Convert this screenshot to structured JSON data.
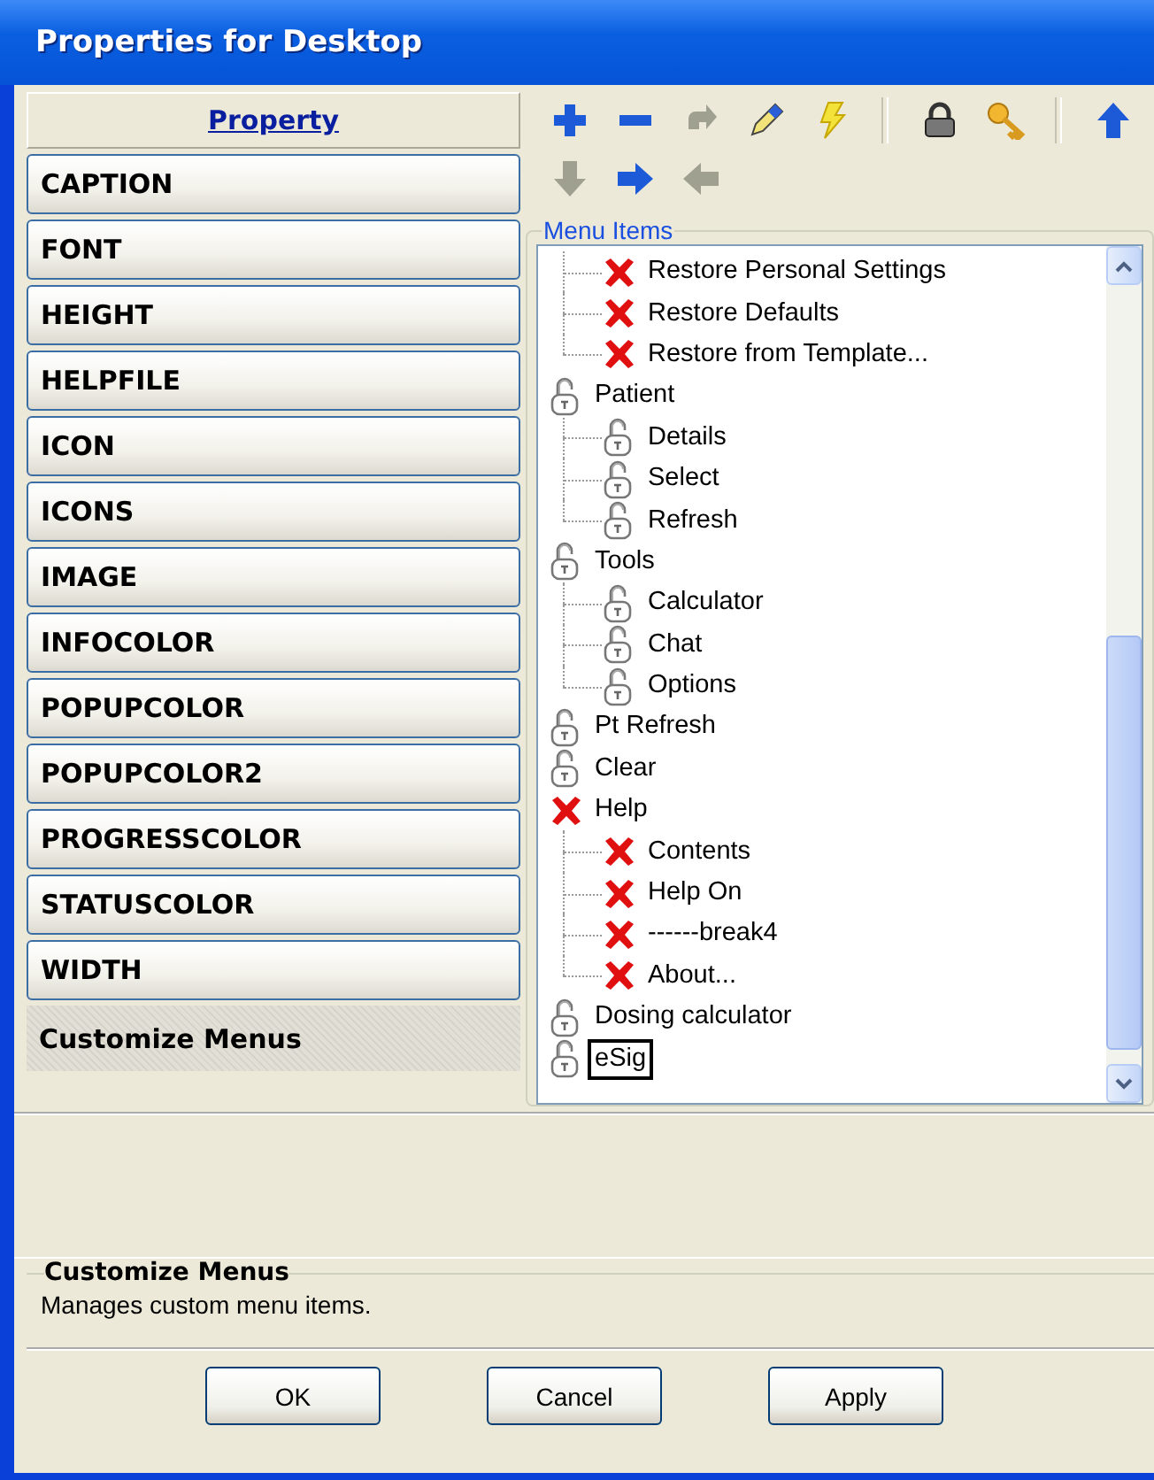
{
  "window": {
    "title": "Properties for Desktop"
  },
  "property_list": {
    "header": "Property",
    "items": [
      {
        "label": "CAPTION",
        "selected": false
      },
      {
        "label": "FONT",
        "selected": false
      },
      {
        "label": "HEIGHT",
        "selected": false
      },
      {
        "label": "HELPFILE",
        "selected": false
      },
      {
        "label": "ICON",
        "selected": false
      },
      {
        "label": "ICONS",
        "selected": false
      },
      {
        "label": "IMAGE",
        "selected": false
      },
      {
        "label": "INFOCOLOR",
        "selected": false
      },
      {
        "label": "POPUPCOLOR",
        "selected": false
      },
      {
        "label": "POPUPCOLOR2",
        "selected": false
      },
      {
        "label": "PROGRESSCOLOR",
        "selected": false
      },
      {
        "label": "STATUSCOLOR",
        "selected": false
      },
      {
        "label": "WIDTH",
        "selected": false
      },
      {
        "label": "Customize Menus",
        "selected": true
      }
    ]
  },
  "toolbar": [
    {
      "kind": "plus",
      "disabled": false
    },
    {
      "kind": "minus",
      "disabled": false
    },
    {
      "kind": "redo",
      "disabled": true
    },
    {
      "kind": "pencil",
      "disabled": false
    },
    {
      "kind": "lightning",
      "disabled": false
    },
    {
      "kind": "separator"
    },
    {
      "kind": "padlock",
      "disabled": false
    },
    {
      "kind": "key",
      "disabled": false
    },
    {
      "kind": "separator"
    },
    {
      "kind": "up",
      "disabled": false
    },
    {
      "kind": "down",
      "disabled": true
    },
    {
      "kind": "right",
      "disabled": false
    },
    {
      "kind": "left",
      "disabled": true
    }
  ],
  "menu_items": {
    "title": "Menu Items",
    "tree": [
      {
        "children": [
          {
            "label": "Restore Personal Settings",
            "kind": "hidden",
            "editing": false
          },
          {
            "label": "Restore Defaults",
            "kind": "hidden",
            "editing": false
          },
          {
            "label": "Restore from Template...",
            "kind": "hidden",
            "editing": false
          }
        ]
      },
      {
        "label": "Patient",
        "kind": "unlocked",
        "editing": false,
        "children": [
          {
            "label": "Details",
            "kind": "unlocked",
            "editing": false
          },
          {
            "label": "Select",
            "kind": "unlocked",
            "editing": false
          },
          {
            "label": "Refresh",
            "kind": "unlocked",
            "editing": false
          }
        ]
      },
      {
        "label": "Tools",
        "kind": "unlocked",
        "editing": false,
        "children": [
          {
            "label": "Calculator",
            "kind": "unlocked",
            "editing": false
          },
          {
            "label": "Chat",
            "kind": "unlocked",
            "editing": false
          },
          {
            "label": "Options",
            "kind": "unlocked",
            "editing": false
          }
        ]
      },
      {
        "label": "Pt Refresh",
        "kind": "unlocked",
        "editing": false
      },
      {
        "label": "Clear",
        "kind": "unlocked",
        "editing": false
      },
      {
        "label": "Help",
        "kind": "hidden",
        "editing": false,
        "children": [
          {
            "label": "Contents",
            "kind": "hidden",
            "editing": false
          },
          {
            "label": "Help On",
            "kind": "hidden",
            "editing": false
          },
          {
            "label": "------break4",
            "kind": "hidden",
            "editing": false
          },
          {
            "label": "About...",
            "kind": "hidden",
            "editing": false
          }
        ]
      },
      {
        "label": "Dosing calculator",
        "kind": "unlocked",
        "editing": false
      },
      {
        "label": "eSig",
        "kind": "unlocked",
        "editing": true
      }
    ]
  },
  "description": {
    "title": "Customize Menus",
    "text": "Manages custom menu items."
  },
  "buttons": [
    "OK",
    "Cancel",
    "Apply"
  ]
}
